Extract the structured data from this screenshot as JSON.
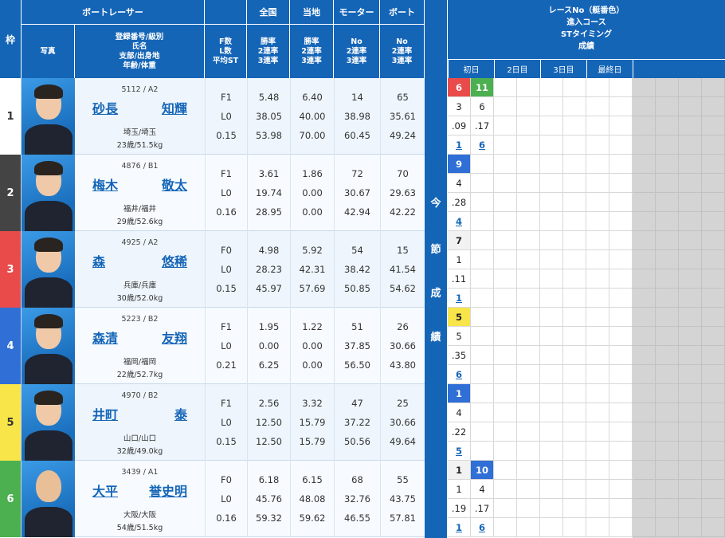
{
  "header": {
    "frame": "枠",
    "racer_group": "ボートレーサー",
    "zenkoku": "全国",
    "touchi": "当地",
    "motor": "モーター",
    "boat": "ボート",
    "photo": "写真",
    "info_lines": [
      "登録番号/級別",
      "氏名",
      "支部/出身地",
      "年齢/体重"
    ],
    "f_lines": [
      "F数",
      "L数",
      "平均ST"
    ],
    "rate_lines": [
      "勝率",
      "2連率",
      "3連率"
    ],
    "no_lines": [
      "No",
      "2連率",
      "3連率"
    ]
  },
  "right_header": {
    "lines": [
      "レースNo（艇番色）",
      "進入コース",
      "STタイミング",
      "成績"
    ],
    "days": [
      "初日",
      "2日目",
      "3日目",
      "最終日"
    ]
  },
  "mid_label": [
    "今",
    "節",
    "成",
    "績"
  ],
  "racers": [
    {
      "frame": "1",
      "frame_color": "#ffffff",
      "frame_text_color": "#333333",
      "reg": "5112 / A2",
      "name_a": "砂長",
      "name_b": "知輝",
      "branch": "埼玉/埼玉",
      "age": "23歳/51.5kg",
      "f": "F1",
      "l": "L0",
      "st": "0.15",
      "zen": [
        "5.48",
        "38.05",
        "53.98"
      ],
      "tou": [
        "6.40",
        "40.00",
        "70.00"
      ],
      "mot": [
        "14",
        "38.98",
        "60.45"
      ],
      "boa": [
        "65",
        "35.61",
        "49.24"
      ],
      "results": [
        {
          "race": "6",
          "race_color": "#e94b4b",
          "course": "3",
          "st": ".09",
          "rank": "1"
        },
        {
          "race": "11",
          "race_color": "#4caf50",
          "course": "6",
          "st": ".17",
          "rank": "6"
        }
      ]
    },
    {
      "frame": "2",
      "frame_color": "#444444",
      "frame_text_color": "#ffffff",
      "reg": "4876 / B1",
      "name_a": "梅木",
      "name_b": "敬太",
      "branch": "福井/福井",
      "age": "29歳/52.6kg",
      "f": "F1",
      "l": "L0",
      "st": "0.16",
      "zen": [
        "3.61",
        "19.74",
        "28.95"
      ],
      "tou": [
        "1.86",
        "0.00",
        "0.00"
      ],
      "mot": [
        "72",
        "30.67",
        "42.94"
      ],
      "boa": [
        "70",
        "29.63",
        "42.22"
      ],
      "results": [
        {
          "race": "9",
          "race_color": "#2f6fd6",
          "course": "4",
          "st": ".28",
          "rank": "4"
        }
      ]
    },
    {
      "frame": "3",
      "frame_color": "#e94b4b",
      "frame_text_color": "#ffffff",
      "reg": "4925 / A2",
      "name_a": "森",
      "name_b": "悠稀",
      "branch": "兵庫/兵庫",
      "age": "30歳/52.0kg",
      "f": "F0",
      "l": "L0",
      "st": "0.15",
      "zen": [
        "4.98",
        "28.23",
        "45.97"
      ],
      "tou": [
        "5.92",
        "42.31",
        "57.69"
      ],
      "mot": [
        "54",
        "38.42",
        "50.85"
      ],
      "boa": [
        "15",
        "41.54",
        "54.62"
      ],
      "results": [
        {
          "race": "7",
          "race_color": "#f2f2f2",
          "course": "1",
          "st": ".11",
          "rank": "1"
        }
      ]
    },
    {
      "frame": "4",
      "frame_color": "#2f6fd6",
      "frame_text_color": "#ffffff",
      "reg": "5223 / B2",
      "name_a": "森清",
      "name_b": "友翔",
      "branch": "福岡/福岡",
      "age": "22歳/52.7kg",
      "f": "F1",
      "l": "L0",
      "st": "0.21",
      "zen": [
        "1.95",
        "0.00",
        "6.25"
      ],
      "tou": [
        "1.22",
        "0.00",
        "0.00"
      ],
      "mot": [
        "51",
        "37.85",
        "56.50"
      ],
      "boa": [
        "26",
        "30.66",
        "43.80"
      ],
      "results": [
        {
          "race": "5",
          "race_color": "#f7e54a",
          "course": "5",
          "st": ".35",
          "rank": "6"
        }
      ]
    },
    {
      "frame": "5",
      "frame_color": "#f7e54a",
      "frame_text_color": "#333333",
      "reg": "4970 / B2",
      "name_a": "井町",
      "name_b": "泰",
      "branch": "山口/山口",
      "age": "32歳/49.0kg",
      "f": "F1",
      "l": "L0",
      "st": "0.15",
      "zen": [
        "2.56",
        "12.50",
        "12.50"
      ],
      "tou": [
        "3.32",
        "15.79",
        "15.79"
      ],
      "mot": [
        "47",
        "37.22",
        "50.56"
      ],
      "boa": [
        "25",
        "30.66",
        "49.64"
      ],
      "results": [
        {
          "race": "1",
          "race_color": "#2f6fd6",
          "course": "4",
          "st": ".22",
          "rank": "5"
        }
      ]
    },
    {
      "frame": "6",
      "frame_color": "#4caf50",
      "frame_text_color": "#ffffff",
      "reg": "3439 / A1",
      "name_a": "大平",
      "name_b": "誉史明",
      "branch": "大阪/大阪",
      "age": "54歳/51.5kg",
      "f": "F0",
      "l": "L0",
      "st": "0.16",
      "zen": [
        "6.18",
        "45.76",
        "59.32"
      ],
      "tou": [
        "6.15",
        "48.08",
        "59.62"
      ],
      "mot": [
        "68",
        "32.76",
        "46.55"
      ],
      "boa": [
        "55",
        "43.75",
        "57.81"
      ],
      "results": [
        {
          "race": "1",
          "race_color": "#f2f2f2",
          "course": "1",
          "st": ".19",
          "rank": "1"
        },
        {
          "race": "10",
          "race_color": "#2f6fd6",
          "course": "4",
          "st": ".17",
          "rank": "6"
        }
      ]
    }
  ]
}
